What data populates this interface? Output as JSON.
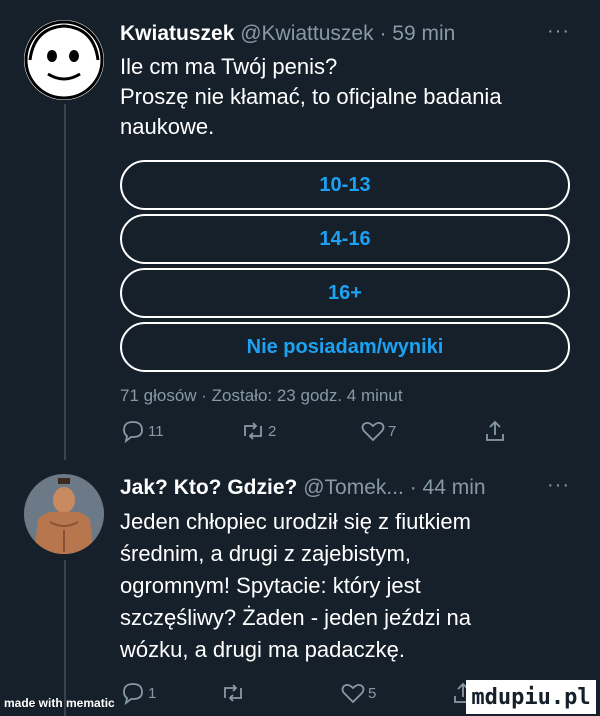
{
  "tweet1": {
    "display_name": "Kwiatuszek",
    "handle": "@Kwiattuszek",
    "time": "· 59 min",
    "more": "···",
    "text_lines": [
      "Ile cm ma Twój penis?",
      "Proszę nie kłamać, to oficjalne badania",
      "naukowe."
    ],
    "poll": {
      "options": [
        "10-13",
        "14-16",
        "16+",
        "Nie posiadam/wyniki"
      ],
      "meta": "71 głosów · Zostało: 23 godz. 4 minut"
    },
    "actions": {
      "replies": "11",
      "retweets": "2",
      "likes": "7"
    }
  },
  "tweet2": {
    "display_name": "Jak? Kto? Gdzie?",
    "handle": "@Tomek...",
    "time": "· 44 min",
    "more": "···",
    "text_lines": [
      "Jeden chłopiec urodził się z fiutkiem",
      "średnim, a drugi z zajebistym,",
      "ogromnym! Spytacie: który jest",
      "szczęśliwy? Żaden - jeden jeździ na",
      "wózku, a drugi ma padaczkę."
    ],
    "actions": {
      "replies": "1",
      "retweets": "",
      "likes": "5"
    }
  },
  "watermarks": {
    "left": "made with mematic",
    "right": "mdupiu.pl"
  },
  "colors": {
    "background": "#15202b",
    "accent": "#1da1f2",
    "muted": "#8899a6"
  }
}
